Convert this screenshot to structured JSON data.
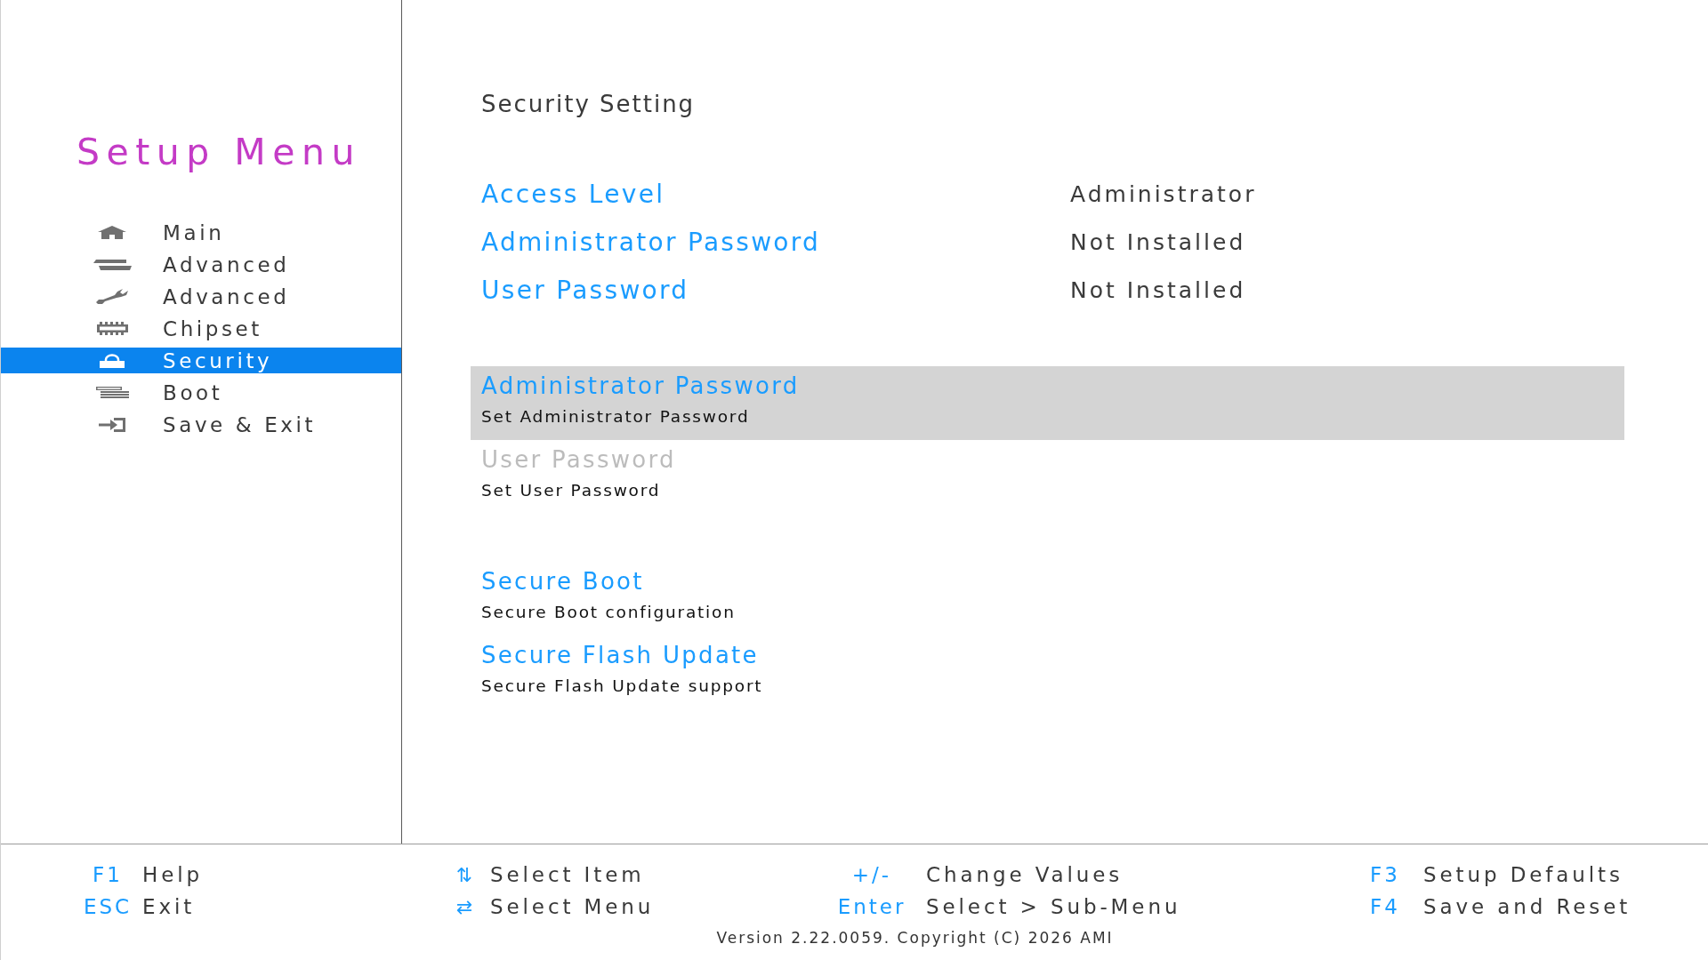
{
  "sidebar": {
    "title": "Setup Menu",
    "items": [
      {
        "label": "Main",
        "selected": false
      },
      {
        "label": "Advanced",
        "selected": false
      },
      {
        "label": "Advanced",
        "selected": false
      },
      {
        "label": "Chipset",
        "selected": false
      },
      {
        "label": "Security",
        "selected": true
      },
      {
        "label": "Boot",
        "selected": false
      },
      {
        "label": "Save & Exit",
        "selected": false
      }
    ]
  },
  "main": {
    "heading": "Security Setting",
    "info_rows": [
      {
        "label": "Access Level",
        "value": "Administrator"
      },
      {
        "label": "Administrator Password",
        "value": "Not Installed"
      },
      {
        "label": "User Password",
        "value": "Not Installed"
      }
    ],
    "item_groups": [
      {
        "items": [
          {
            "title": "Administrator Password",
            "description": "Set Administrator Password",
            "selected": true,
            "disabled": false
          },
          {
            "title": "User Password",
            "description": "Set User Password",
            "selected": false,
            "disabled": true
          }
        ]
      },
      {
        "items": [
          {
            "title": "Secure Boot",
            "description": "Secure Boot configuration",
            "selected": false,
            "disabled": false
          },
          {
            "title": "Secure Flash Update",
            "description": "Secure Flash Update support",
            "selected": false,
            "disabled": false
          }
        ]
      }
    ]
  },
  "footer": {
    "key_columns": [
      {
        "rows": [
          {
            "kind": "key",
            "key": "F1",
            "action": "Help"
          },
          {
            "kind": "key",
            "key": "ESC",
            "action": "Exit"
          }
        ]
      },
      {
        "rows": [
          {
            "kind": "glyph",
            "key": "⇅",
            "action": "Select Item"
          },
          {
            "kind": "glyph",
            "key": "⇄",
            "action": "Select Menu"
          }
        ]
      },
      {
        "rows": [
          {
            "kind": "key",
            "key": "+/-",
            "action": "Change Values"
          },
          {
            "kind": "key",
            "key": "Enter",
            "action": "Select > Sub-Menu"
          }
        ]
      },
      {
        "rows": [
          {
            "kind": "key",
            "key": "F3",
            "action": "Setup Defaults"
          },
          {
            "kind": "key",
            "key": "F4",
            "action": "Save and Reset"
          }
        ]
      }
    ],
    "version": "Version 2.22.0059. Copyright (C) 2026 AMI"
  }
}
